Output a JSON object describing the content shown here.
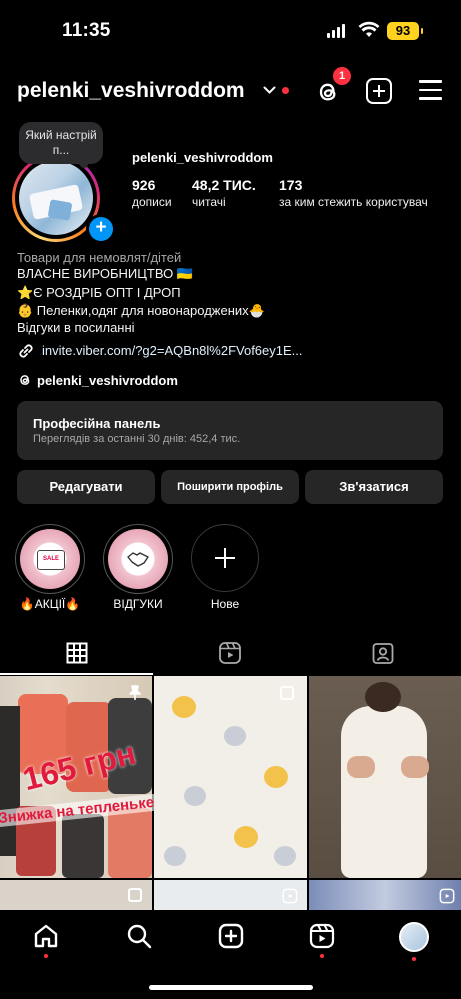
{
  "status_bar": {
    "time": "11:35",
    "battery": "93"
  },
  "header": {
    "username": "pelenki_veshivroddom",
    "threads_notification_count": "1"
  },
  "profile": {
    "note": "Який настрій п...",
    "name": "pelenki_veshivroddom",
    "stats": [
      {
        "value": "926",
        "label": "дописи"
      },
      {
        "value": "48,2 ТИС.",
        "label": "читачі"
      },
      {
        "value": "173",
        "label": "за ким стежить користувач"
      }
    ]
  },
  "bio": {
    "category": "Товари для немовлят/дітей",
    "lines": [
      "ВЛАСНЕ ВИРОБНИЦТВО 🇺🇦",
      "⭐️Є РОЗДРІБ ОПТ І ДРОП",
      "👶 Пеленки,одяг для новонароджених🐣",
      "Відгуки в посиланні"
    ],
    "link": "invite.viber.com/?g2=AQBn8l%2FVof6ey1E...",
    "threads_handle": "pelenki_veshivroddom"
  },
  "pro_panel": {
    "title": "Професійна панель",
    "subtitle": "Переглядів за останні 30 днів: 452,4 тис."
  },
  "actions": {
    "edit": "Редагувати",
    "share": "Поширити профіль",
    "contact": "Зв'язатися"
  },
  "highlights": [
    {
      "label": "🔥АКЦІЇ🔥",
      "badge": "SALE"
    },
    {
      "label": "ВІДГУКИ"
    },
    {
      "label": "Нове"
    }
  ],
  "grid": {
    "post1_price": "165 грн",
    "post1_caption": "Знижка на тепленьке"
  },
  "colors": {
    "accent_red": "#ff3040",
    "link_blue": "#0095f6",
    "panel": "#262626"
  }
}
